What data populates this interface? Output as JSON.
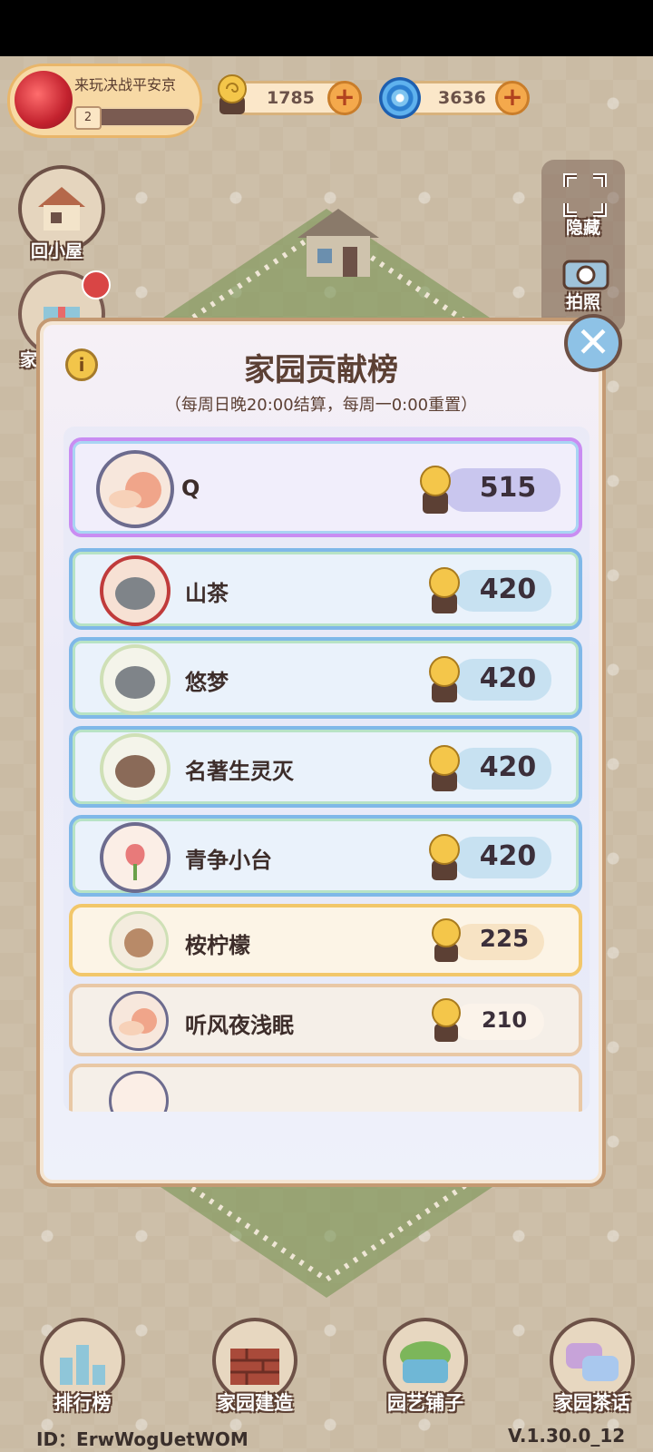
{
  "hud": {
    "event_title": "来玩决战平安京",
    "event_level": "2",
    "snail_coins": "1785",
    "swirl_coins": "3636",
    "plus_label": "+"
  },
  "side": {
    "home_label": "回小屋",
    "gift_label": "家",
    "hide_label": "隐藏",
    "photo_label": "拍照"
  },
  "modal": {
    "title": "家园贡献榜",
    "subtitle": "（每周日晚20:00结算，每周一0:00重置）",
    "info_label": "i",
    "close_label": "✕",
    "rows": [
      {
        "name": "Q",
        "score": "515"
      },
      {
        "name": "山茶",
        "score": "420"
      },
      {
        "name": "悠梦",
        "score": "420"
      },
      {
        "name": "名著生灵灭",
        "score": "420"
      },
      {
        "name": "青争小台",
        "score": "420"
      },
      {
        "name": "桉柠檬",
        "score": "225"
      },
      {
        "name": "听风夜浅眠",
        "score": "210"
      }
    ]
  },
  "nav": {
    "rank": "排行榜",
    "build": "家园建造",
    "shop": "园艺铺子",
    "chat": "家园茶话"
  },
  "footer": {
    "id": "ID：ErwWogUetWOM",
    "version": "V.1.30.0_12"
  },
  "colors": {
    "frame": "#c49a73",
    "title_text": "#5c4034",
    "first_place": "#c78af0",
    "top_frame": "#7fb8e8",
    "gold_frame": "#f2c76a",
    "plain_frame": "#e9c8a5"
  }
}
